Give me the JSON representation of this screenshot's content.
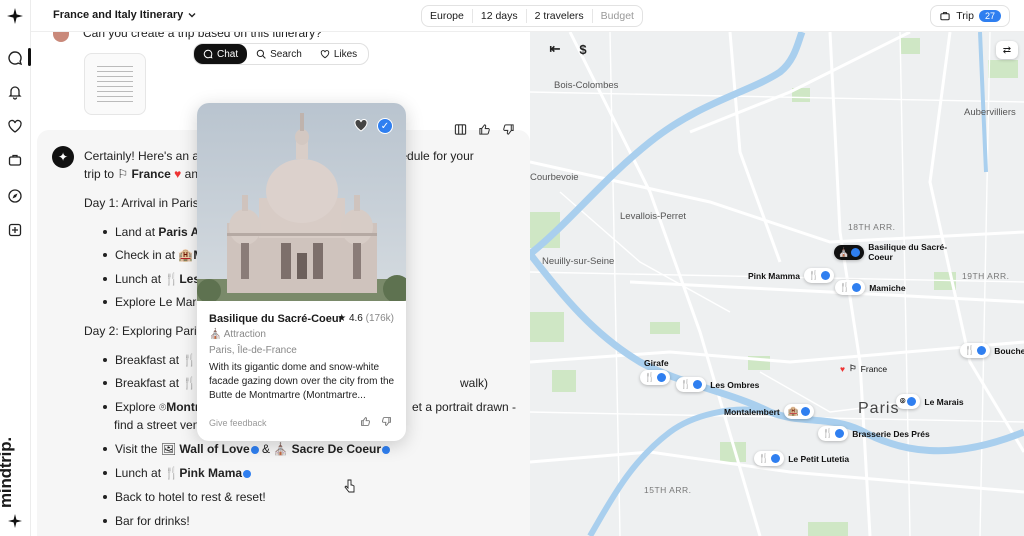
{
  "topbar": {
    "title": "France and Italy Itinerary",
    "pills": [
      "Europe",
      "12 days",
      "2 travelers",
      "Budget"
    ],
    "trip_label": "Trip",
    "trip_count": "27"
  },
  "rail": {
    "brand": "mindtrip.",
    "icons": [
      "sparkle-icon",
      "chat-icon",
      "bell-icon",
      "heart-icon",
      "suitcase-icon",
      "compass-icon",
      "plus-square-icon"
    ]
  },
  "chat": {
    "user_question": "Can you create a trip based on this itinerary?",
    "tabs": [
      "Chat",
      "Search",
      "Likes"
    ],
    "intro_1a": "Certainly! Here's an a",
    "intro_1b": "ed schedule for your",
    "intro_2a": "trip to",
    "intro_france": "France",
    "intro_2b": "an",
    "day1": "Day 1: Arrival in Paris",
    "day1_items": [
      {
        "pre": "Land at ",
        "bold": "Paris Airp"
      },
      {
        "pre": "Check in at ",
        "bold": "Mo"
      },
      {
        "pre": "Lunch at ",
        "bold": "Les O"
      },
      {
        "pre": "Explore Le Marais",
        "bold": ""
      }
    ],
    "day2": "Day 2: Exploring Paris",
    "day2_items": [
      {
        "pre": "Breakfast at ",
        "bold": "Br",
        "post": ""
      },
      {
        "pre": "Breakfast at ",
        "bold": "Ch",
        "post": "walk)"
      },
      {
        "pre": "Explore ",
        "bold": "Montm",
        "post": "et a portrait drawn -"
      }
    ],
    "day2_wrap": "find a street vend",
    "visit_pre": "Visit the",
    "visit_a": "Wall of Love",
    "visit_amp": "&",
    "visit_b": "Sacre De Coeur",
    "lunch_pre": "Lunch at",
    "lunch_b": "Pink Mama",
    "back": "Back to hotel to rest & reset!",
    "bar": "Bar for drinks!"
  },
  "card": {
    "name": "Basilique du Sacré-Coeur",
    "rating": "4.6",
    "reviews": "(176k)",
    "category": "Attraction",
    "location": "Paris, Île-de-France",
    "description": "With its gigantic dome and snow-white facade gazing down over the city from the Butte de Montmartre (Montmartre...",
    "feedback": "Give feedback"
  },
  "map": {
    "places": [
      "Bois-Colombes",
      "Courbevoie",
      "Levallois-Perret",
      "Neuilly-sur-Seine",
      "Aubervilliers"
    ],
    "arrondissements": [
      "18TH ARR.",
      "19TH ARR.",
      "15TH ARR."
    ],
    "city": "Paris",
    "pins": [
      "Basilique du Sacré-Coeur",
      "Pink Mamma",
      "Mamiche",
      "Girafe",
      "Les Ombres",
      "France",
      "Le Marais",
      "Montalembert",
      "Brasserie Des Prés",
      "Le Petit Lutetia",
      "Bouche"
    ],
    "dollar": "$"
  },
  "colors": {
    "accent": "#2f7ff0",
    "water": "#a9cfee",
    "park": "#cfe7c5",
    "road": "#ffffff"
  }
}
